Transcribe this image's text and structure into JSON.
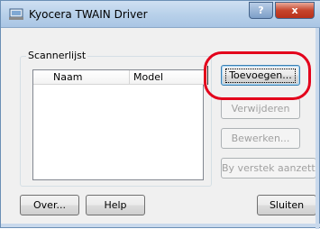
{
  "window": {
    "title": "Kyocera TWAIN Driver",
    "help_glyph": "?",
    "close_glyph": "x"
  },
  "scanner_list": {
    "group_label": "Scannerlijst",
    "columns": [
      "Naam",
      "Model"
    ],
    "rows": []
  },
  "side_buttons": {
    "add": "Toevoegen...",
    "remove": "Verwijderen",
    "edit": "Bewerken...",
    "set_default": "By verstek aanzetten"
  },
  "bottom_buttons": {
    "about": "Over...",
    "help": "Help",
    "close": "Sluiten"
  },
  "colors": {
    "highlight": "#e3001b",
    "title_gradient": "#b9d1ea",
    "close_button": "#c6452c"
  }
}
